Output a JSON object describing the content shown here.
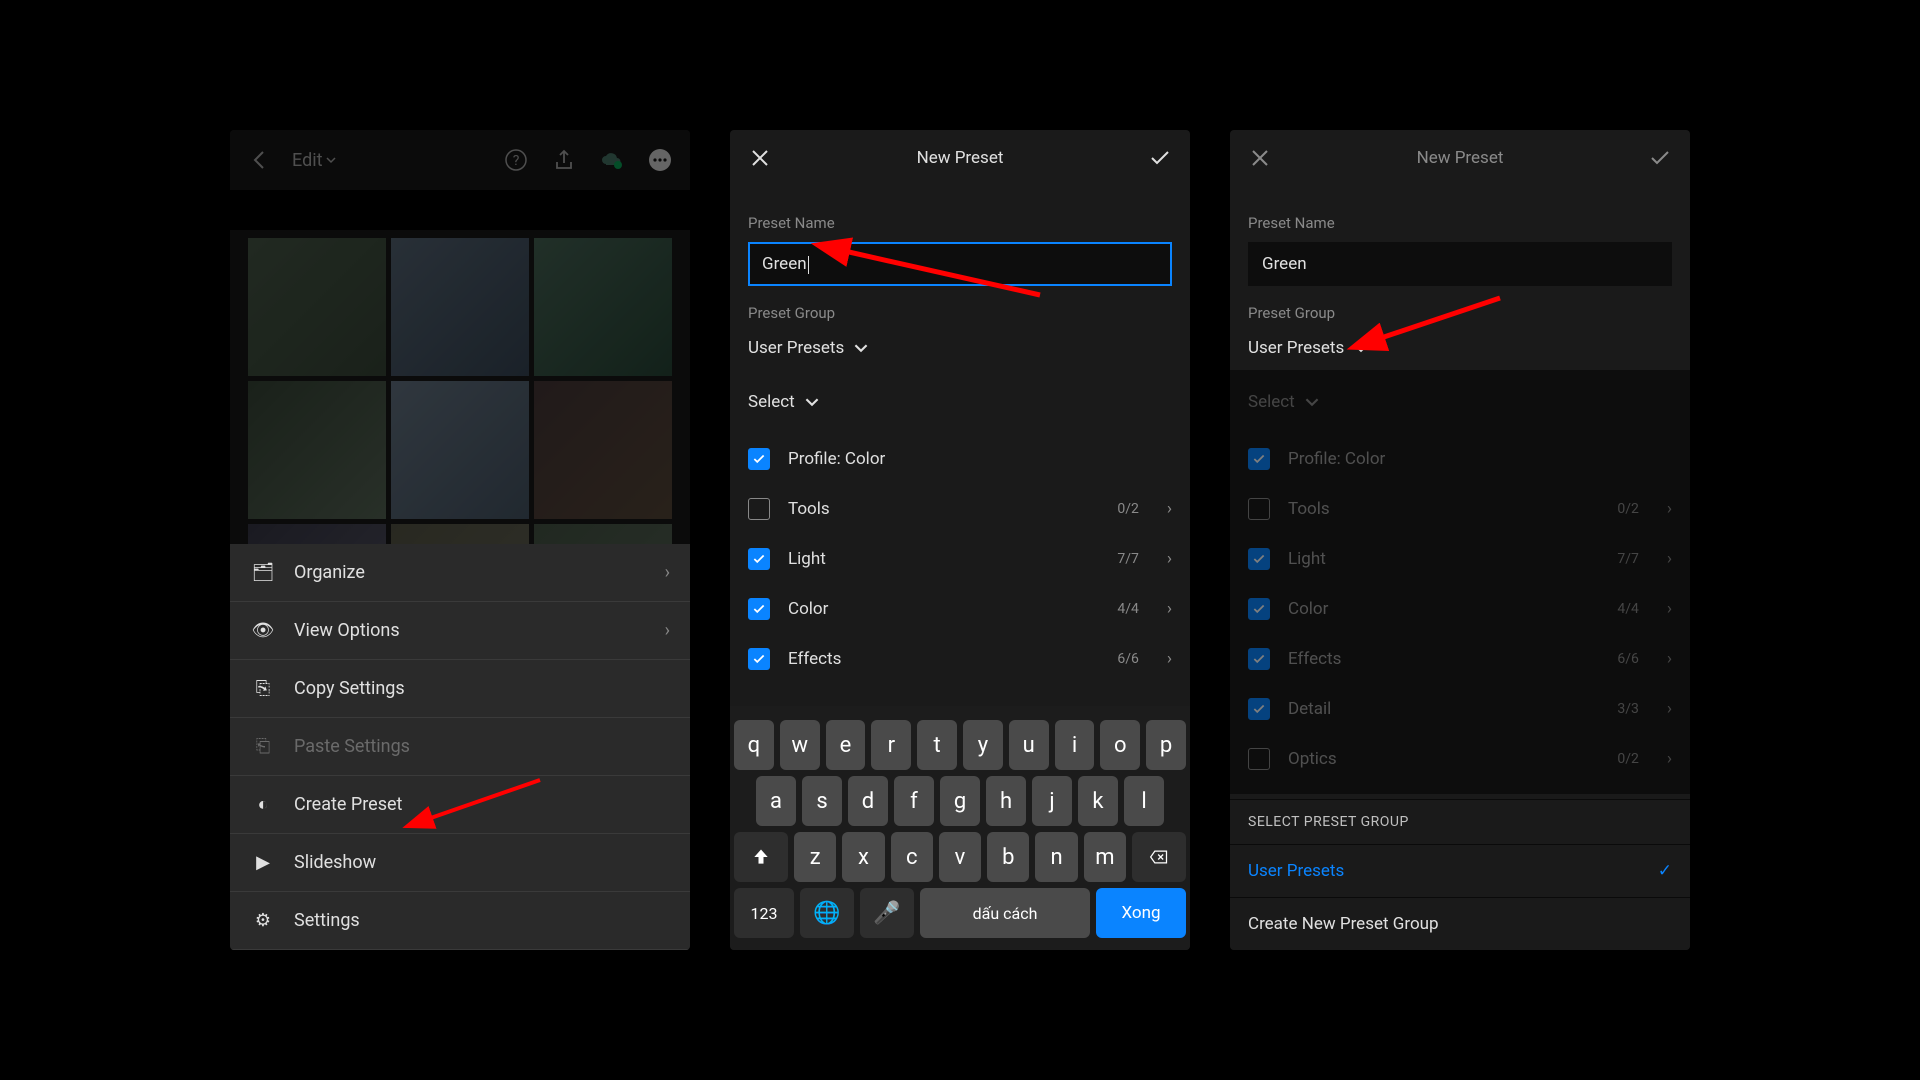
{
  "panel1": {
    "edit_label": "Edit",
    "menu": {
      "organize": "Organize",
      "view_options": "View Options",
      "copy_settings": "Copy Settings",
      "paste_settings": "Paste Settings",
      "create_preset": "Create Preset",
      "slideshow": "Slideshow",
      "settings": "Settings"
    }
  },
  "panel2": {
    "title": "New Preset",
    "preset_name_label": "Preset Name",
    "preset_name_value": "Green",
    "preset_group_label": "Preset Group",
    "preset_group_value": "User Presets",
    "select_label": "Select",
    "options": {
      "profile": "Profile: Color",
      "tools": "Tools",
      "tools_count": "0/2",
      "light": "Light",
      "light_count": "7/7",
      "color": "Color",
      "color_count": "4/4",
      "effects": "Effects",
      "effects_count": "6/6"
    },
    "keyboard": {
      "num_key": "123",
      "space_label": "dấu cách",
      "done_label": "Xong"
    }
  },
  "panel3": {
    "title": "New Preset",
    "preset_name_label": "Preset Name",
    "preset_name_value": "Green",
    "preset_group_label": "Preset Group",
    "preset_group_value": "User Presets",
    "select_label": "Select",
    "options": {
      "profile": "Profile: Color",
      "tools": "Tools",
      "tools_count": "0/2",
      "light": "Light",
      "light_count": "7/7",
      "color": "Color",
      "color_count": "4/4",
      "effects": "Effects",
      "effects_count": "6/6",
      "detail": "Detail",
      "detail_count": "3/3",
      "optics": "Optics",
      "optics_count": "0/2"
    },
    "sheet": {
      "header": "SELECT PRESET GROUP",
      "user_presets": "User Presets",
      "create_new": "Create New Preset Group"
    }
  }
}
